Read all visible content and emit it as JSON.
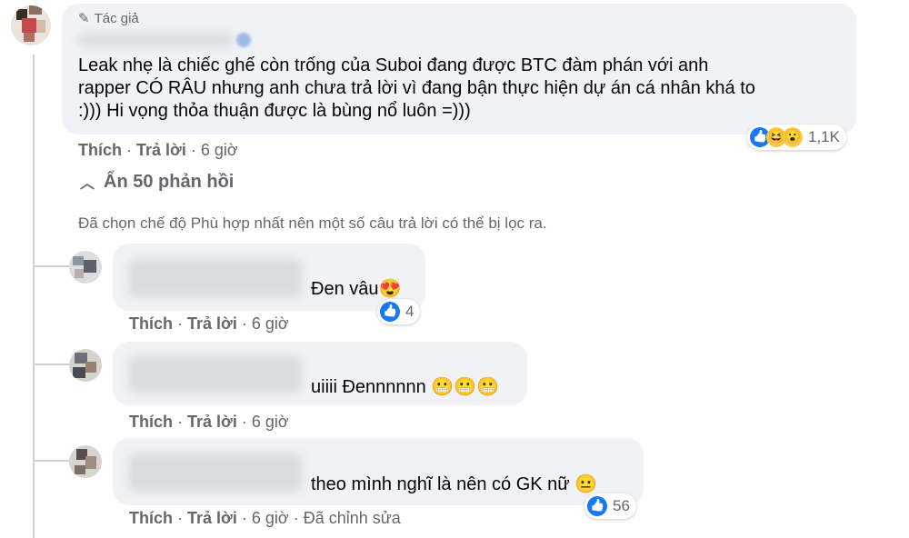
{
  "main_comment": {
    "badge": "Tác giả",
    "text": "Leak nhẹ là chiếc ghế còn trống của Suboi đang được BTC đàm phán với anh rapper CÓ RÂU nhưng anh chưa trả lời vì đang bận thực hiện dự án cá nhân khá to :))) Hi vọng thỏa thuận được là bùng nổ luôn =)))",
    "line1": "Leak nhẹ là chiếc ghế còn trống của Suboi đang được BTC đàm phán với anh",
    "line2": "rapper CÓ RÂU nhưng anh chưa trả lời vì đang bận thực hiện dự án cá nhân khá to",
    "line3": ":))) Hi vọng thỏa thuận được là bùng nổ luôn =)))",
    "reaction_count": "1,1K",
    "like": "Thích",
    "reply": "Trả lời",
    "time": "6 giờ"
  },
  "hide_replies": "Ẩn 50 phản hồi",
  "filter_note": "Đã chọn chế độ Phù hợp nhất nên một số câu trả lời có thể bị lọc ra.",
  "replies": [
    {
      "text": "Đen vâu",
      "emoji": "😍",
      "reaction_count": "4",
      "like": "Thích",
      "reply": "Trả lời",
      "time": "6 giờ"
    },
    {
      "text": "uiiii Đennnnnn",
      "emoji": "😬😬😬",
      "like": "Thích",
      "reply": "Trả lời",
      "time": "6 giờ"
    },
    {
      "text": "theo mình nghĩ là nên có GK nữ",
      "emoji": "😐",
      "reaction_count": "56",
      "like": "Thích",
      "reply": "Trả lời",
      "time": "6 giờ",
      "edited": "Đã chỉnh sửa"
    }
  ],
  "colors": {
    "bubble": "#f0f2f5",
    "meta": "#65676b",
    "like_blue": "#1877f2"
  }
}
